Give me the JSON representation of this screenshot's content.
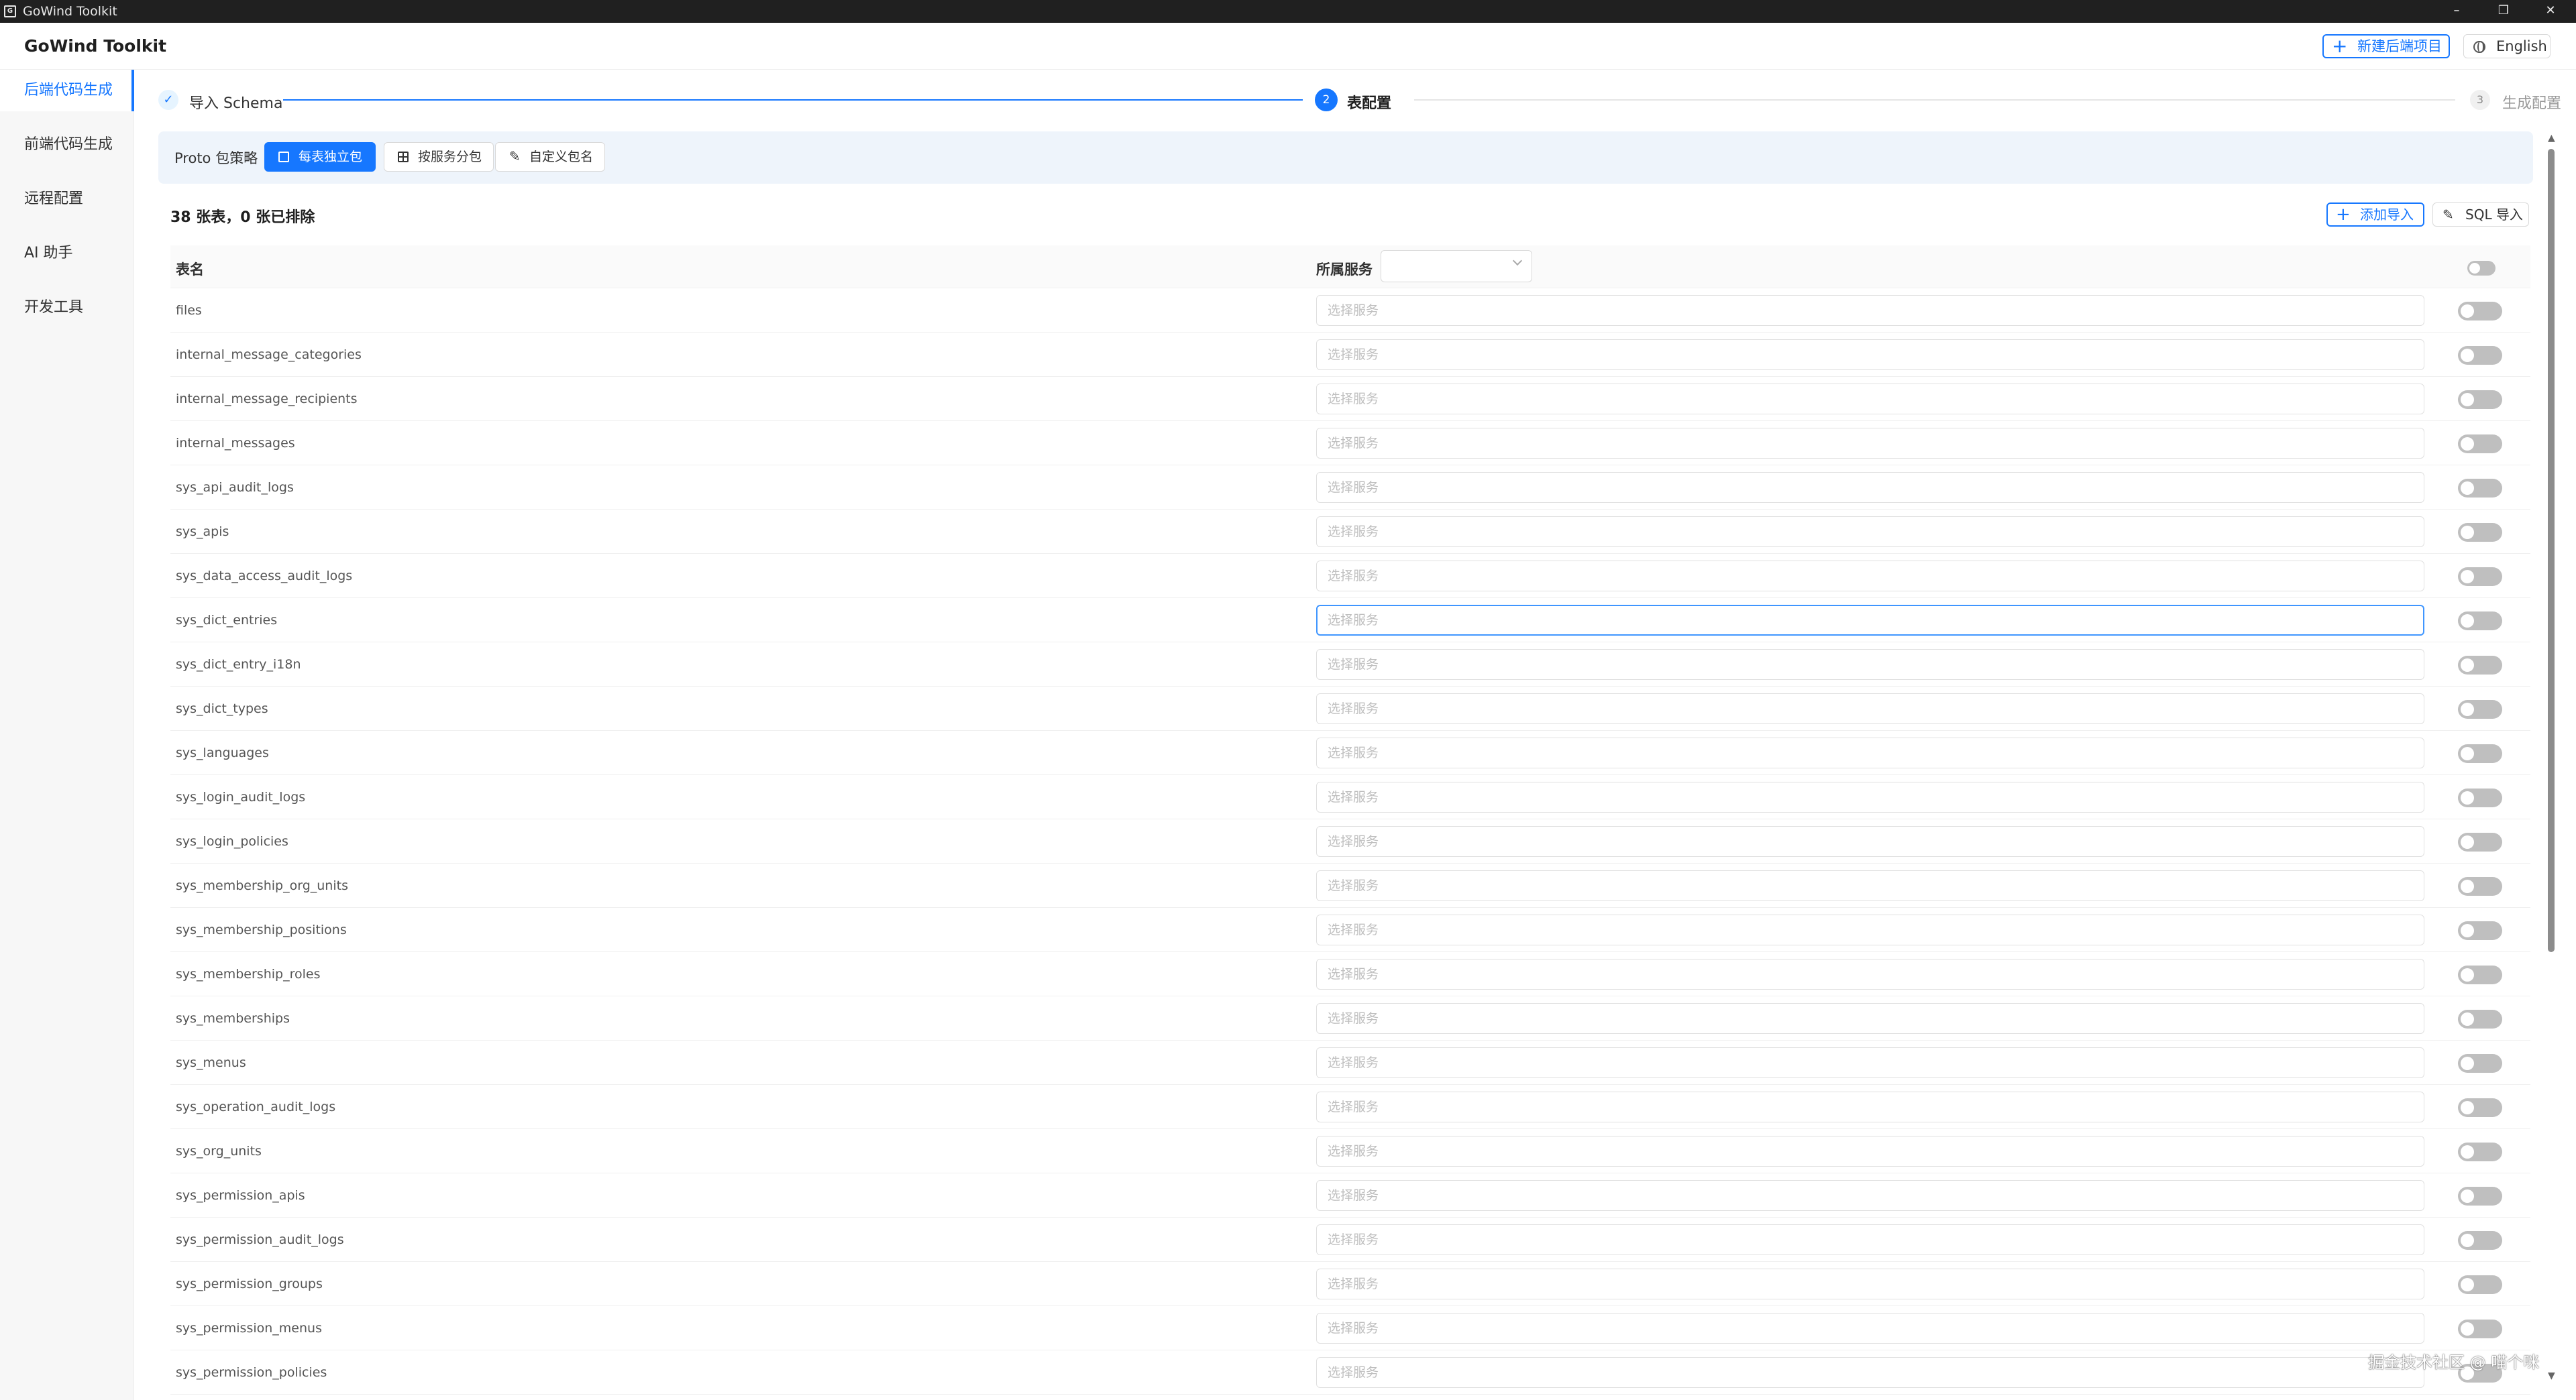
{
  "window": {
    "title": "GoWind Toolkit",
    "controls": {
      "minimize": "–",
      "maximize": "❐",
      "close": "✕"
    }
  },
  "header": {
    "brand": "GoWind Toolkit",
    "new_project_button": "新建后端项目",
    "language_button": "English"
  },
  "sidebar": {
    "items": [
      {
        "label": "后端代码生成",
        "active": true
      },
      {
        "label": "前端代码生成",
        "active": false
      },
      {
        "label": "远程配置",
        "active": false
      },
      {
        "label": "AI 助手",
        "active": false
      },
      {
        "label": "开发工具",
        "active": false
      }
    ]
  },
  "steps": {
    "step1": {
      "check": "✓",
      "label": "导入 Schema"
    },
    "step2": {
      "number": "2",
      "label": "表配置"
    },
    "step3": {
      "number": "3",
      "label": "生成配置"
    }
  },
  "strategy": {
    "label": "Proto 包策略",
    "options": [
      {
        "label": "每表独立包",
        "active": true
      },
      {
        "label": "按服务分包",
        "active": false
      },
      {
        "label": "自定义包名",
        "active": false
      }
    ]
  },
  "summary": {
    "text": "38 张表，0 张已排除"
  },
  "actions": {
    "add_import": "添加导入",
    "sql_import": "SQL 导入"
  },
  "table": {
    "columns": {
      "name": "表名",
      "service": "所属服务"
    },
    "service_placeholder": "选择服务",
    "focused_row": "sys_dict_entries",
    "rows": [
      "files",
      "internal_message_categories",
      "internal_message_recipients",
      "internal_messages",
      "sys_api_audit_logs",
      "sys_apis",
      "sys_data_access_audit_logs",
      "sys_dict_entries",
      "sys_dict_entry_i18n",
      "sys_dict_types",
      "sys_languages",
      "sys_login_audit_logs",
      "sys_login_policies",
      "sys_membership_org_units",
      "sys_membership_positions",
      "sys_membership_roles",
      "sys_memberships",
      "sys_menus",
      "sys_operation_audit_logs",
      "sys_org_units",
      "sys_permission_apis",
      "sys_permission_audit_logs",
      "sys_permission_groups",
      "sys_permission_menus",
      "sys_permission_policies"
    ]
  },
  "watermark": "掘金技术社区 @ 喵个咪",
  "colors": {
    "accent": "#1677ff",
    "toggle_off": "#bfbfbf",
    "sidebar_bg": "#f7f7f7",
    "strategy_bg": "#eef4fb"
  }
}
